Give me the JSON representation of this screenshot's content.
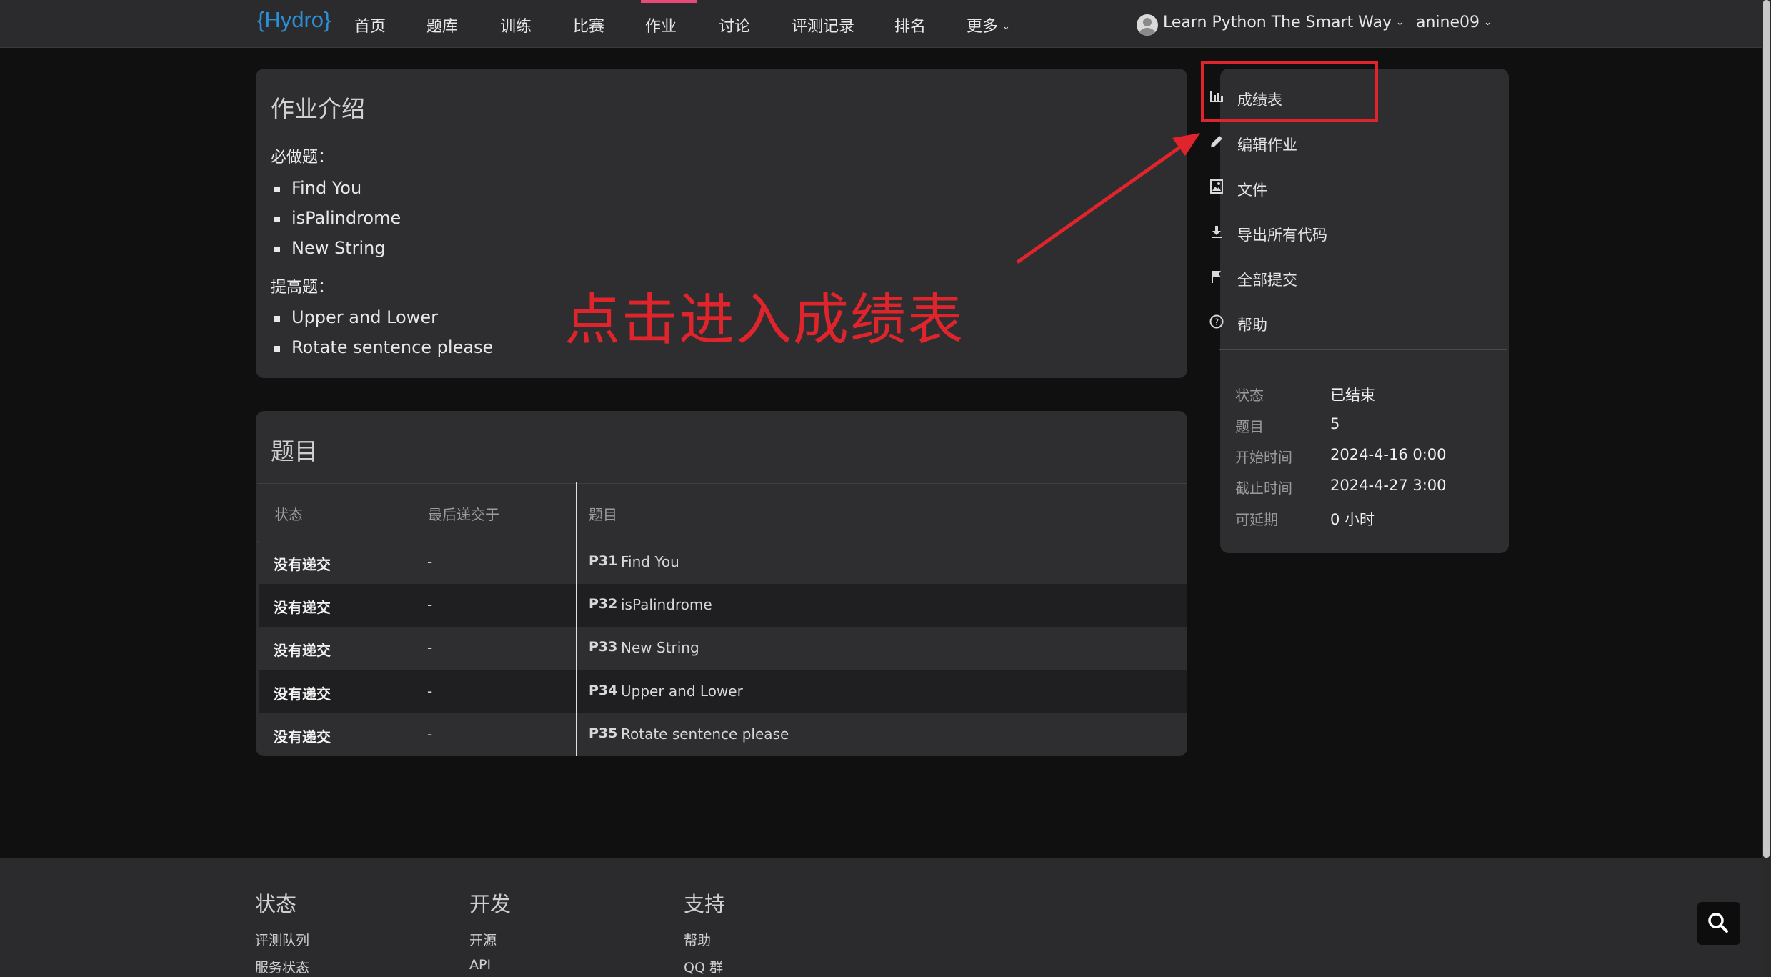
{
  "nav": {
    "logo": "{Hydro}",
    "items": [
      "首页",
      "题库",
      "训练",
      "比赛",
      "作业",
      "讨论",
      "评测记录",
      "排名",
      "更多"
    ],
    "domain_label": "Learn Python The Smart Way",
    "user_label": "anine09"
  },
  "intro": {
    "title": "作业介绍",
    "required_label": "必做题：",
    "required": [
      "Find You",
      "isPalindrome",
      "New String"
    ],
    "advanced_label": "提高题：",
    "advanced": [
      "Upper and Lower",
      "Rotate sentence please"
    ]
  },
  "annotation": "点击进入成绩表",
  "sidebar": {
    "menu": [
      "成绩表",
      "编辑作业",
      "文件",
      "导出所有代码",
      "全部提交",
      "帮助"
    ],
    "info": [
      {
        "k": "状态",
        "v": "已结束"
      },
      {
        "k": "题目",
        "v": "5"
      },
      {
        "k": "开始时间",
        "v": "2024-4-16 0:00"
      },
      {
        "k": "截止时间",
        "v": "2024-4-27 3:00"
      },
      {
        "k": "可延期",
        "v": "0 小时"
      }
    ]
  },
  "problems": {
    "title": "题目",
    "headers": [
      "状态",
      "最后递交于",
      "题目"
    ],
    "rows": [
      {
        "status": "没有递交",
        "last": "-",
        "pid": "P31",
        "name": "Find You"
      },
      {
        "status": "没有递交",
        "last": "-",
        "pid": "P32",
        "name": "isPalindrome"
      },
      {
        "status": "没有递交",
        "last": "-",
        "pid": "P33",
        "name": "New String"
      },
      {
        "status": "没有递交",
        "last": "-",
        "pid": "P34",
        "name": "Upper and Lower"
      },
      {
        "status": "没有递交",
        "last": "-",
        "pid": "P35",
        "name": "Rotate sentence please"
      }
    ]
  },
  "footer": {
    "cols": [
      {
        "head": "状态",
        "links": [
          "评测队列",
          "服务状态"
        ]
      },
      {
        "head": "开发",
        "links": [
          "开源",
          "API"
        ]
      },
      {
        "head": "支持",
        "links": [
          "帮助",
          "QQ 群"
        ]
      }
    ]
  },
  "colors": {
    "accent": "#e84a78",
    "annotation": "#e0242c",
    "logo": "#2b8fd6"
  },
  "icons": [
    "chart-bar-icon",
    "pencil-icon",
    "file-image-icon",
    "download-icon",
    "flag-icon",
    "help-circle-icon",
    "search-icon",
    "chevron-down-icon",
    "user-avatar-icon"
  ]
}
